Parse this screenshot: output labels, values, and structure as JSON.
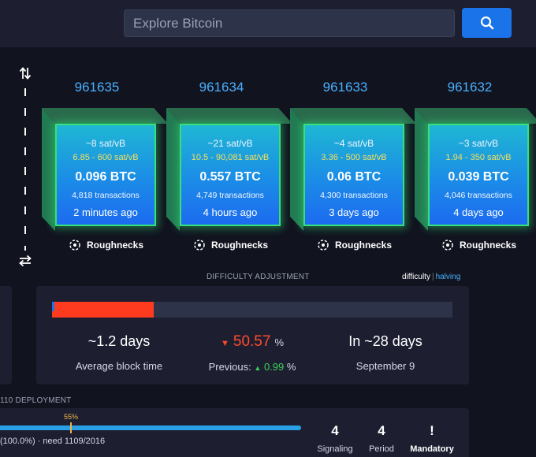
{
  "search": {
    "placeholder": "Explore Bitcoin"
  },
  "blocks": [
    {
      "height": "961635",
      "median_fee": "~8 sat/vB",
      "fee_range": "6.85 - 600 sat/vB",
      "total": "0.096 BTC",
      "tx_count": "4,818 transactions",
      "time_ago": "2 minutes ago",
      "miner": "Roughnecks"
    },
    {
      "height": "961634",
      "median_fee": "~21 sat/vB",
      "fee_range": "10.5 - 90,081 sat/vB",
      "total": "0.557 BTC",
      "tx_count": "4,749 transactions",
      "time_ago": "4 hours ago",
      "miner": "Roughnecks"
    },
    {
      "height": "961633",
      "median_fee": "~4 sat/vB",
      "fee_range": "3.36 - 500 sat/vB",
      "total": "0.06 BTC",
      "tx_count": "4,300 transactions",
      "time_ago": "3 days ago",
      "miner": "Roughnecks"
    },
    {
      "height": "961632",
      "median_fee": "~3 sat/vB",
      "fee_range": "1.94 - 350 sat/vB",
      "total": "0.039 BTC",
      "tx_count": "4,046 transactions",
      "time_ago": "4 days ago",
      "miner": "Roughnecks"
    }
  ],
  "difficulty": {
    "section_title": "DIFFICULTY ADJUSTMENT",
    "toggle_difficulty": "difficulty",
    "toggle_separator": "|",
    "toggle_halving": "halving",
    "progress_fraction": 0.253,
    "avg_block_time_value": "~1.2 days",
    "avg_block_time_label": "Average block time",
    "change_arrow": "▼",
    "change_value": "50.57",
    "change_unit": "%",
    "previous_label": "Previous:",
    "previous_arrow": "▲",
    "previous_value": "0.99",
    "previous_unit": "%",
    "eta_value": "In ~28 days",
    "eta_date": "September 9"
  },
  "deployment": {
    "section_title": "110 DEPLOYMENT",
    "marker_label": "55%",
    "status_text": "(100.0%) · need 1109/2016",
    "signaling_value": "4",
    "signaling_label": "Signaling",
    "period_value": "4",
    "period_label": "Period",
    "mandatory_value": "!",
    "mandatory_label": "Mandatory"
  },
  "colors": {
    "background": "#11131f",
    "panel": "#1d1f31",
    "accent_blue": "#1a73e8",
    "block_border": "#36e07a",
    "fee_range": "#f4e15a",
    "negative": "#ff4a2a",
    "positive": "#3bd15b"
  }
}
